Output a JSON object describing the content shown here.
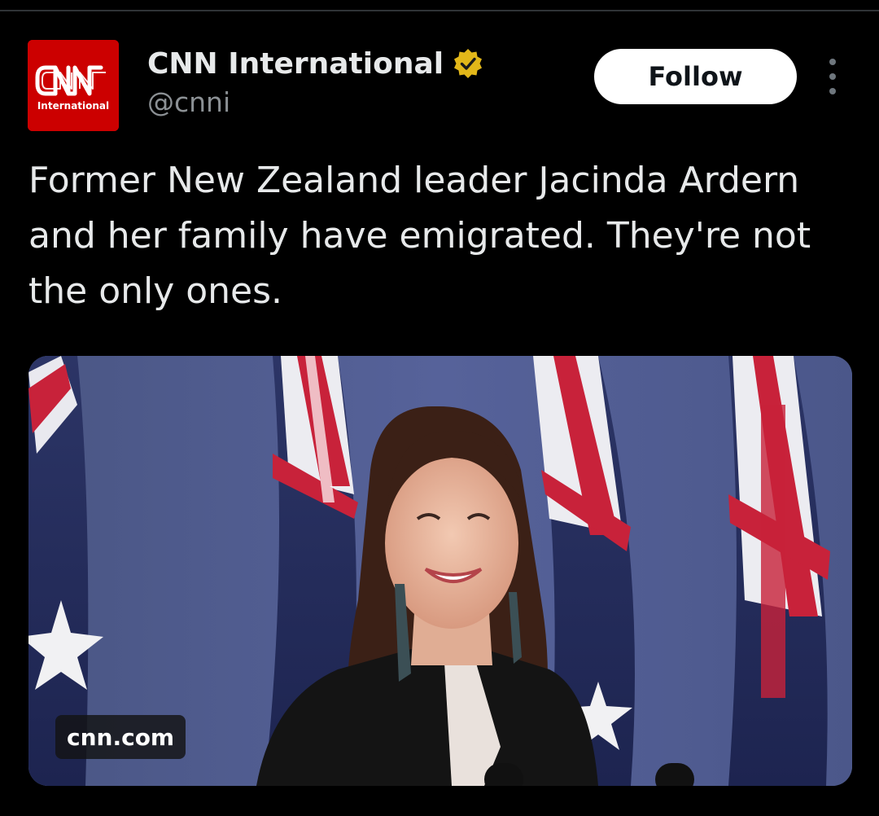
{
  "account": {
    "avatar_logo": "CNN",
    "avatar_subtitle": "International",
    "display_name": "CNN International",
    "handle": "@cnni",
    "verified": true,
    "verified_badge_color": "#e2b719"
  },
  "actions": {
    "follow_label": "Follow",
    "more_icon": "more-vertical-icon"
  },
  "tweet": {
    "text": "Former New Zealand leader Jacinda Ardern\nand her family have emigrated. They're not\nthe only ones."
  },
  "media": {
    "type": "link-card-image",
    "domain": "cnn.com"
  },
  "colors": {
    "background": "#000000",
    "text_primary": "#e7e9ea",
    "text_secondary": "#8b9094",
    "brand_red": "#cc0000",
    "follow_bg": "#ffffff"
  }
}
